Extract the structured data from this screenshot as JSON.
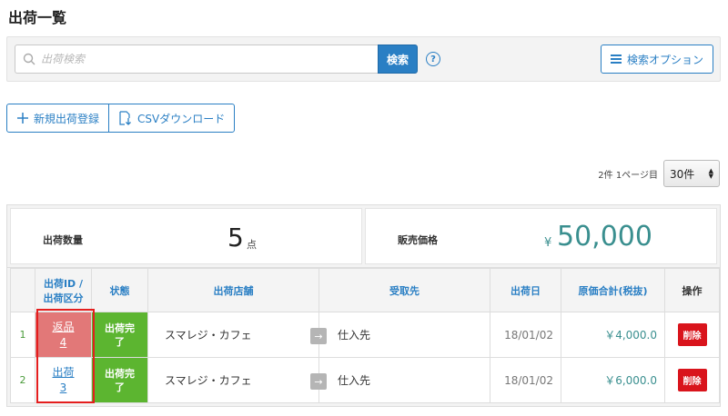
{
  "page": {
    "title": "出荷一覧"
  },
  "search": {
    "placeholder": "出荷検索",
    "button_label": "検索",
    "help_label": "?",
    "options_label": "検索オプション"
  },
  "actions": {
    "new_label": "新規出荷登録",
    "csv_label": "CSVダウンロード"
  },
  "paging": {
    "info": "2件 1ページ目",
    "per_page": "30件"
  },
  "summary": {
    "quantity_label": "出荷数量",
    "quantity_value": "5",
    "quantity_unit": "点",
    "price_label": "販売価格",
    "price_symbol": "¥",
    "price_value": "50,000"
  },
  "table": {
    "headers": {
      "id": [
        "出荷ID /",
        "出荷区分"
      ],
      "status": "状態",
      "store": "出荷店舗",
      "receiver": "受取先",
      "date": "出荷日",
      "cost": "原価合計(税抜)",
      "ops": "操作"
    },
    "rows": [
      {
        "num": "1",
        "type": "返品",
        "id": "4",
        "status": [
          "出荷完",
          "了"
        ],
        "store": "スマレジ・カフェ",
        "arrow": "→",
        "receiver": "仕入先",
        "date": "18/01/02",
        "cost": "￥4,000.0",
        "delete": "削除"
      },
      {
        "num": "2",
        "type": "出荷",
        "id": "3",
        "status": [
          "出荷完",
          "了"
        ],
        "store": "スマレジ・カフェ",
        "arrow": "→",
        "receiver": "仕入先",
        "date": "18/01/02",
        "cost": "￥6,000.0",
        "delete": "削除"
      }
    ]
  },
  "colors": {
    "accent": "#2a7fc4",
    "status_done": "#5cb530",
    "return_bg": "#e27878",
    "delete": "#d9141c",
    "price": "#3a8f8f",
    "highlight": "#e41e1e"
  }
}
